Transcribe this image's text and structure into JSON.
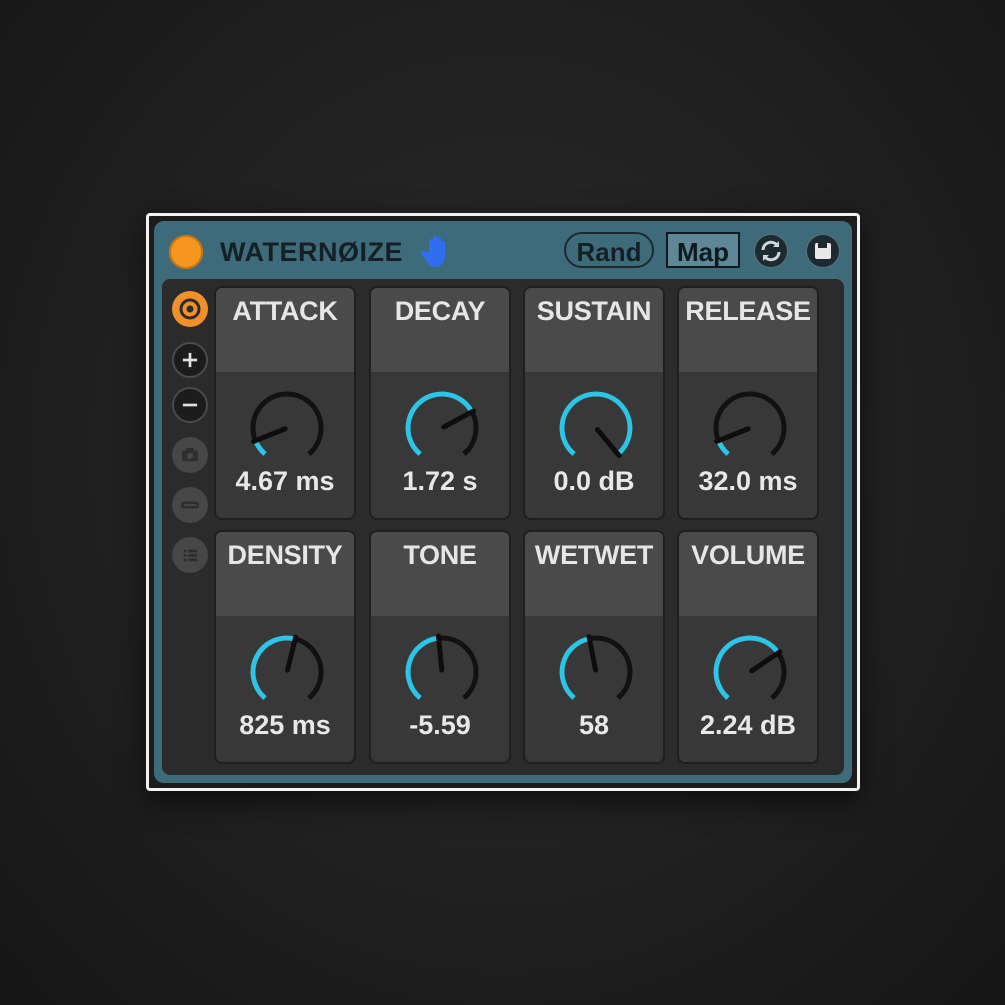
{
  "device": {
    "title": "WATERNØIZE",
    "rand_label": "Rand",
    "map_label": "Map",
    "accent_color": "#2ec4e6",
    "power_color": "#f5961f"
  },
  "sidebar": {
    "icons": [
      "preset-icon",
      "plus-icon",
      "minus-icon",
      "camera-icon",
      "minus-bar-icon",
      "list-icon"
    ]
  },
  "params": [
    {
      "label": "ATTACK",
      "value": "4.67 ms",
      "fraction": 0.1
    },
    {
      "label": "DECAY",
      "value": "1.72 s",
      "fraction": 0.72
    },
    {
      "label": "SUSTAIN",
      "value": "0.0 dB",
      "fraction": 1.0
    },
    {
      "label": "RELEASE",
      "value": "32.0 ms",
      "fraction": 0.1
    },
    {
      "label": "DENSITY",
      "value": "825 ms",
      "fraction": 0.55
    },
    {
      "label": "TONE",
      "value": "-5.59",
      "fraction": 0.48
    },
    {
      "label": "WETWET",
      "value": "58",
      "fraction": 0.46
    },
    {
      "label": "VOLUME",
      "value": "2.24 dB",
      "fraction": 0.7
    }
  ]
}
